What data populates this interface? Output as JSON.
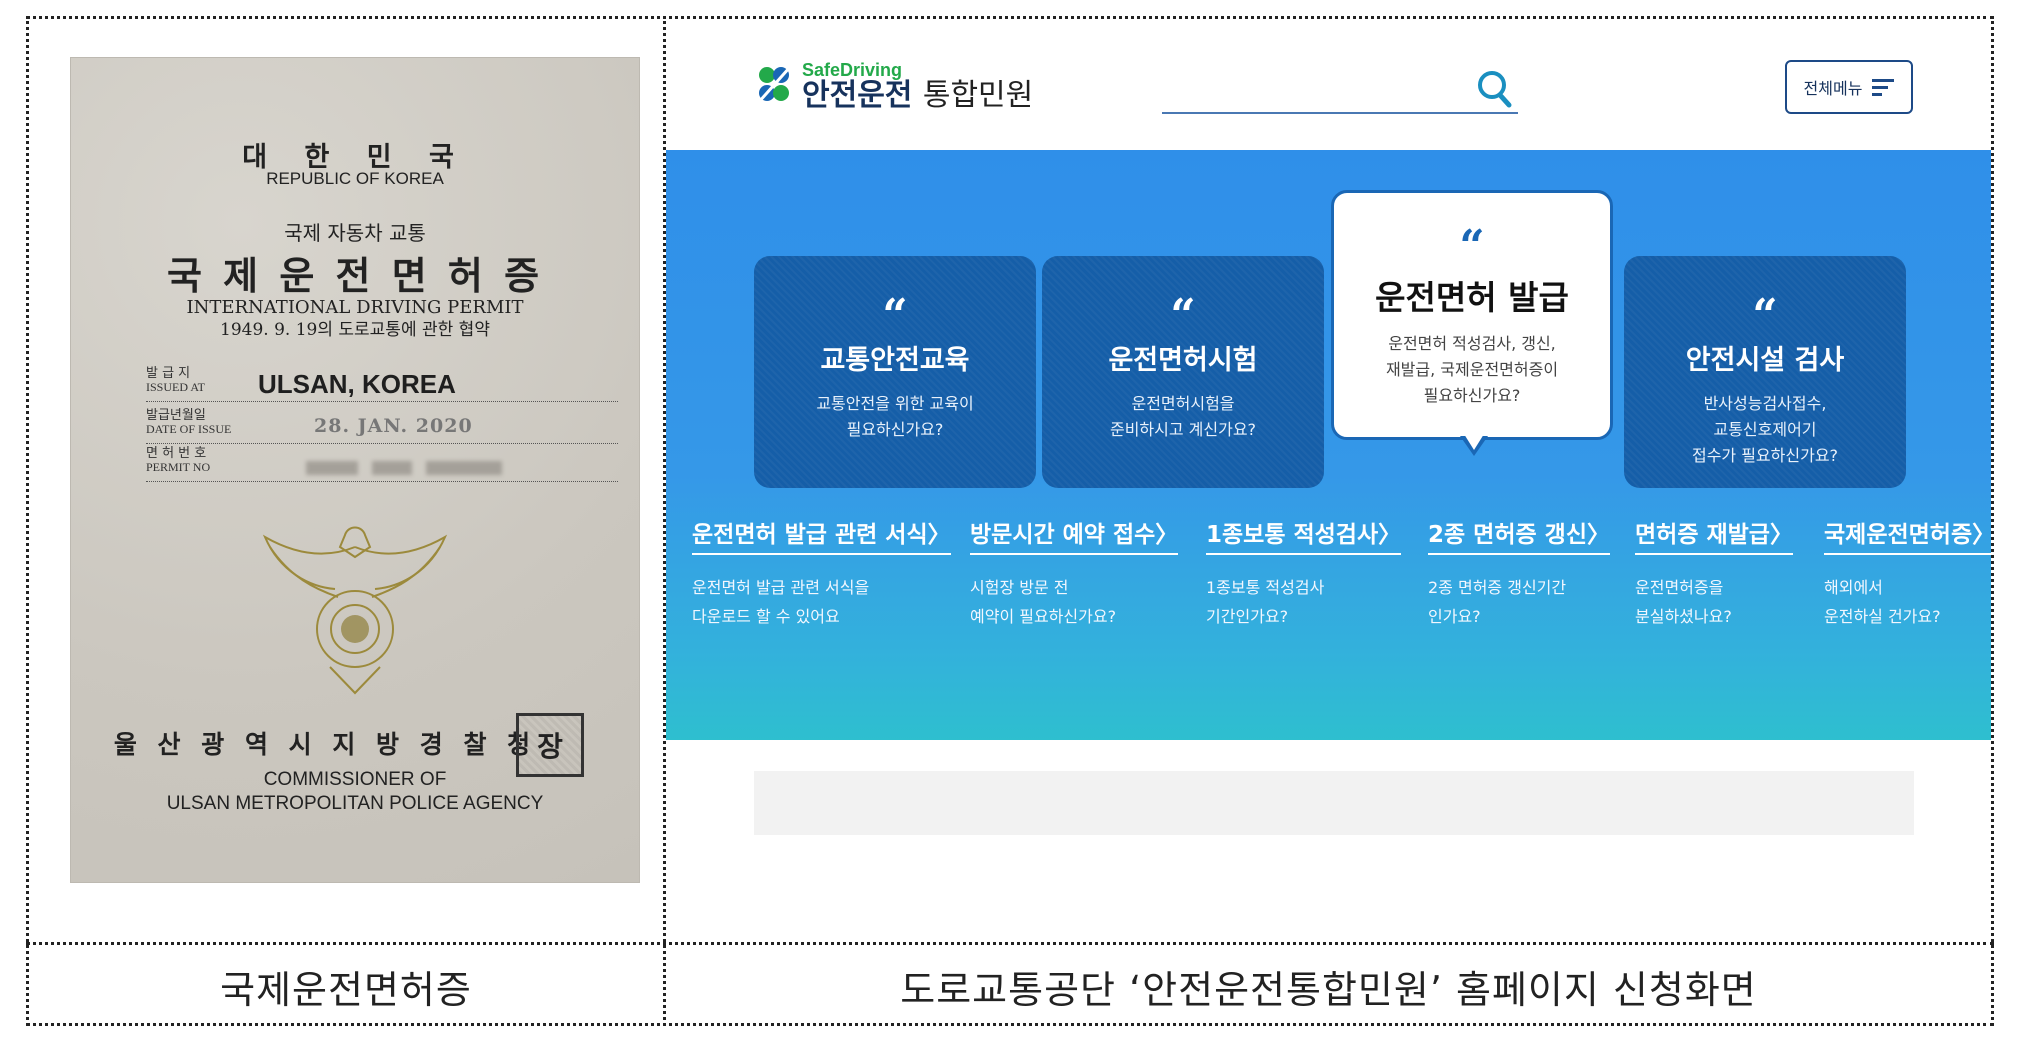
{
  "captions": {
    "left": "국제운전면허증",
    "right": "도로교통공단 ‘안전운전통합민원’ 홈페이지 신청화면"
  },
  "permit": {
    "country_ko": "대 한 민 국",
    "country_en": "REPUBLIC OF KOREA",
    "subtitle_ko": "국제 자동차 교통",
    "title_ko": "국 제 운 전 면 허 증",
    "title_en": "INTERNATIONAL DRIVING PERMIT",
    "convention": "1949. 9. 19의 도로교통에 관한 협약",
    "issued_at_label_ko": "발 급 지",
    "issued_at_label_en": "ISSUED AT",
    "issued_at_value": "ULSAN, KOREA",
    "date_label_ko": "발급년월일",
    "date_label_en": "DATE OF ISSUE",
    "date_value": "28. JAN. 2020",
    "permit_label_ko": "면 허 번 호",
    "permit_label_en": "PERMIT NO",
    "issuer_ko": "울 산 광 역 시 지 방 경 찰 청",
    "issuer_en_1": "COMMISSIONER OF",
    "issuer_en_2": "ULSAN METROPOLITAN POLICE AGENCY",
    "stamp_char": "장"
  },
  "site": {
    "logo_small": "SafeDriving",
    "logo_main": "안전운전",
    "logo_sub": "통합민원",
    "menu_label": "전체메뉴",
    "cards": [
      {
        "quote": "“",
        "title": "교통안전교육",
        "desc1": "교통안전을 위한 교육이",
        "desc2": "필요하신가요?",
        "desc3": ""
      },
      {
        "quote": "“",
        "title": "운전면허시험",
        "desc1": "운전면허시험을",
        "desc2": "준비하시고 계신가요?",
        "desc3": ""
      },
      {
        "quote": "“",
        "title": "운전면허 발급",
        "desc1": "운전면허 적성검사, 갱신,",
        "desc2": "재발급, 국제운전면허증이",
        "desc3": "필요하신가요?"
      },
      {
        "quote": "“",
        "title": "안전시설 검사",
        "desc1": "반사성능검사접수,",
        "desc2": "교통신호제어기",
        "desc3": "접수가 필요하신가요?"
      }
    ],
    "links": [
      {
        "title": "운전면허 발급 관련 서식〉",
        "d1": "운전면허 발급 관련 서식을",
        "d2": "다운로드 할 수 있어요"
      },
      {
        "title": "방문시간 예약 접수〉",
        "d1": "시험장 방문 전",
        "d2": "예약이 필요하신가요?"
      },
      {
        "title": "1종보통 적성검사〉",
        "d1": "1종보통 적성검사",
        "d2": "기간인가요?"
      },
      {
        "title": "2종 면허증 갱신〉",
        "d1": "2종 면허증 갱신기간",
        "d2": "인가요?"
      },
      {
        "title": "면허증 재발급〉",
        "d1": "운전면허증을",
        "d2": "분실하셨나요?"
      },
      {
        "title": "국제운전면허증〉",
        "d1": "해외에서",
        "d2": "운전하실 건가요?"
      }
    ],
    "colors": {
      "hero_top": "#2f8fe9",
      "hero_bottom": "#2ebfcf",
      "card": "#155ea8",
      "brand_green": "#23a94a",
      "brand_navy": "#16325c"
    }
  }
}
